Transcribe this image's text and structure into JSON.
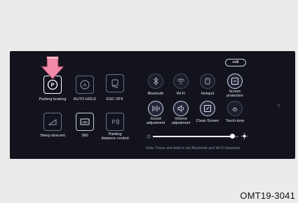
{
  "screen": {
    "edit_label": "edit",
    "left_tiles": [
      {
        "label": "Parking braking",
        "icon": "parking-brake-icon",
        "active": true
      },
      {
        "label": "AUTO HOLD",
        "icon": "auto-hold-icon"
      },
      {
        "label": "ESC OFF",
        "icon": "esc-off-icon"
      },
      {
        "label": "Steep descent",
        "icon": "steep-descent-icon"
      },
      {
        "label": "360",
        "icon": "camera-360-icon"
      },
      {
        "label": "Parking\ndistance control",
        "icon": "parking-distance-icon"
      }
    ],
    "quick_toggles": [
      {
        "label": "Bluetooth",
        "icon": "bluetooth-icon"
      },
      {
        "label": "Wi-Fi",
        "icon": "wifi-icon"
      },
      {
        "label": "Hotspot",
        "icon": "hotspot-icon"
      },
      {
        "label": "Screen\nprotection",
        "icon": "screen-protection-icon"
      },
      {
        "label": "Sound\nadjustment",
        "icon": "sound-adjustment-icon"
      },
      {
        "label": "Volume\nadjustment",
        "icon": "volume-icon"
      },
      {
        "label": "Clean Screen",
        "icon": "clean-screen-icon"
      },
      {
        "label": "Touch-tone",
        "icon": "touch-tone-icon"
      }
    ],
    "brightness": {
      "level": 0.93
    },
    "note": "Note: Press and hold to set Bluetooth and Wi-Fi functions"
  },
  "caption": "OMT19-3041",
  "colors": {
    "screen_bg": "#12131d",
    "callout_arrow": "#f08aa6",
    "page_bg": "#ebebeb"
  }
}
